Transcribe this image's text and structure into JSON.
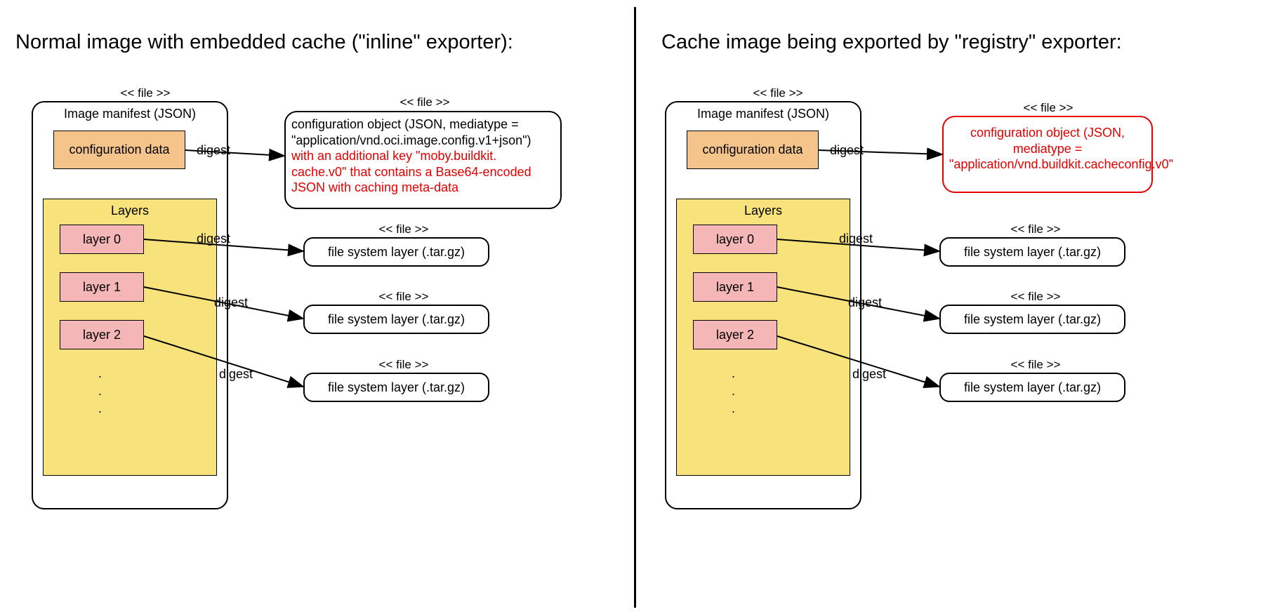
{
  "titles": {
    "left": "Normal image with embedded cache (\"inline\" exporter):",
    "right": "Cache image being exported by \"registry\" exporter:"
  },
  "stereotype_file": "<< file >>",
  "manifest_label": "Image manifest (JSON)",
  "config_chip": "configuration data",
  "layers_label": "Layers",
  "layer_labels": [
    "layer 0",
    "layer 1",
    "layer 2"
  ],
  "digest_label": "digest",
  "fs_layer_label": "file system layer (.tar.gz)",
  "dots": ". . .",
  "left_config": {
    "line1_black": "configuration object (JSON, mediatype = \"application/vnd.oci.image.config.v1+json\")",
    "line2_red": "with an additional key \"moby.buildkit. cache.v0\" that contains a Base64-encoded JSON with caching meta-data"
  },
  "right_config": {
    "text": "configuration object (JSON, mediatype = \"application/vnd.buildkit.cacheconfig.v0\""
  },
  "colors": {
    "orange": "#f4c48a",
    "pink": "#f4b6b6",
    "yellow": "#f7e27b",
    "red": "#e50000"
  }
}
